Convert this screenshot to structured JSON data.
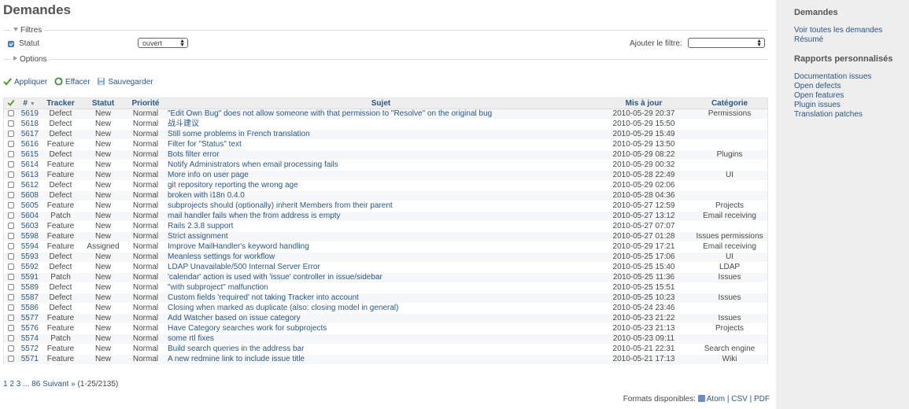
{
  "page": {
    "title": "Demandes"
  },
  "filters": {
    "legend": "Filtres",
    "statut_label": "Statut",
    "statut_value": "ouvert",
    "add_filter_label": "Ajouter le filtre:",
    "add_filter_value": "",
    "options_legend": "Options"
  },
  "actions": {
    "apply": "Appliquer",
    "clear": "Effacer",
    "save": "Sauvegarder"
  },
  "table": {
    "headers": [
      "#",
      "Tracker",
      "Statut",
      "Priorité",
      "Sujet",
      "Mis à jour",
      "Catégorie"
    ],
    "rows": [
      {
        "id": "5619",
        "tracker": "Defect",
        "status": "New",
        "priority": "Normal",
        "subject": "\"Edit Own Bug\" does not allow someone with that permission to \"Resolve\" on the original bug",
        "updated": "2010-05-29 20:37",
        "category": "Permissions"
      },
      {
        "id": "5618",
        "tracker": "Defect",
        "status": "New",
        "priority": "Normal",
        "subject": "战斗建议",
        "updated": "2010-05-29 15:50",
        "category": ""
      },
      {
        "id": "5617",
        "tracker": "Defect",
        "status": "New",
        "priority": "Normal",
        "subject": "Still some problems in French translation",
        "updated": "2010-05-29 15:49",
        "category": ""
      },
      {
        "id": "5616",
        "tracker": "Feature",
        "status": "New",
        "priority": "Normal",
        "subject": "Filter for \"Status\" text",
        "updated": "2010-05-29 13:50",
        "category": ""
      },
      {
        "id": "5615",
        "tracker": "Defect",
        "status": "New",
        "priority": "Normal",
        "subject": "Bots filter error",
        "updated": "2010-05-29 08:22",
        "category": "Plugins"
      },
      {
        "id": "5614",
        "tracker": "Feature",
        "status": "New",
        "priority": "Normal",
        "subject": "Notify Administrators when email processing fails",
        "updated": "2010-05-29 00:32",
        "category": ""
      },
      {
        "id": "5613",
        "tracker": "Feature",
        "status": "New",
        "priority": "Normal",
        "subject": "More info on user page",
        "updated": "2010-05-28 22:49",
        "category": "UI"
      },
      {
        "id": "5612",
        "tracker": "Defect",
        "status": "New",
        "priority": "Normal",
        "subject": "git repository reporting the wrong age",
        "updated": "2010-05-29 02:06",
        "category": ""
      },
      {
        "id": "5608",
        "tracker": "Defect",
        "status": "New",
        "priority": "Normal",
        "subject": "broken with i18n 0.4.0",
        "updated": "2010-05-28 04:36",
        "category": ""
      },
      {
        "id": "5605",
        "tracker": "Feature",
        "status": "New",
        "priority": "Normal",
        "subject": "subprojects should (optionally) inherit Members from their parent",
        "updated": "2010-05-27 12:59",
        "category": "Projects"
      },
      {
        "id": "5604",
        "tracker": "Patch",
        "status": "New",
        "priority": "Normal",
        "subject": "mail handler fails when the from address is empty",
        "updated": "2010-05-27 13:12",
        "category": "Email receiving"
      },
      {
        "id": "5603",
        "tracker": "Feature",
        "status": "New",
        "priority": "Normal",
        "subject": "Rails 2.3.8 support",
        "updated": "2010-05-27 07:07",
        "category": ""
      },
      {
        "id": "5598",
        "tracker": "Feature",
        "status": "New",
        "priority": "Normal",
        "subject": "Strict assignment",
        "updated": "2010-05-27 01:28",
        "category": "Issues permissions"
      },
      {
        "id": "5594",
        "tracker": "Feature",
        "status": "Assigned",
        "priority": "Normal",
        "subject": "Improve MailHandler's keyword handling",
        "updated": "2010-05-29 17:21",
        "category": "Email receiving"
      },
      {
        "id": "5593",
        "tracker": "Defect",
        "status": "New",
        "priority": "Normal",
        "subject": "Meanless settings for workflow",
        "updated": "2010-05-25 17:06",
        "category": "UI"
      },
      {
        "id": "5592",
        "tracker": "Defect",
        "status": "New",
        "priority": "Normal",
        "subject": "LDAP Unavailable/500 Internal Server Error",
        "updated": "2010-05-25 15:40",
        "category": "LDAP"
      },
      {
        "id": "5591",
        "tracker": "Patch",
        "status": "New",
        "priority": "Normal",
        "subject": "'calendar' action is used with 'issue' controller in issue/sidebar",
        "updated": "2010-05-25 11:36",
        "category": "Issues"
      },
      {
        "id": "5589",
        "tracker": "Defect",
        "status": "New",
        "priority": "Normal",
        "subject": "\"with subproject\" malfunction",
        "updated": "2010-05-25 15:51",
        "category": ""
      },
      {
        "id": "5587",
        "tracker": "Defect",
        "status": "New",
        "priority": "Normal",
        "subject": "Custom fields 'required' not taking Tracker into account",
        "updated": "2010-05-25 10:23",
        "category": "Issues"
      },
      {
        "id": "5586",
        "tracker": "Defect",
        "status": "New",
        "priority": "Normal",
        "subject": "Closing when marked as duplicate (also: closing model in general)",
        "updated": "2010-05-24 23:46",
        "category": ""
      },
      {
        "id": "5577",
        "tracker": "Feature",
        "status": "New",
        "priority": "Normal",
        "subject": "Add Watcher based on issue category",
        "updated": "2010-05-23 21:22",
        "category": "Issues"
      },
      {
        "id": "5576",
        "tracker": "Feature",
        "status": "New",
        "priority": "Normal",
        "subject": "Have Category searches work for subprojects",
        "updated": "2010-05-23 21:13",
        "category": "Projects"
      },
      {
        "id": "5574",
        "tracker": "Patch",
        "status": "New",
        "priority": "Normal",
        "subject": "some rtl fixes",
        "updated": "2010-05-23 09:11",
        "category": ""
      },
      {
        "id": "5572",
        "tracker": "Feature",
        "status": "New",
        "priority": "Normal",
        "subject": "Build search queries in the address bar",
        "updated": "2010-05-21 22:31",
        "category": "Search engine"
      },
      {
        "id": "5571",
        "tracker": "Feature",
        "status": "New",
        "priority": "Normal",
        "subject": "A new redmine link to include issue title",
        "updated": "2010-05-21 17:13",
        "category": "Wiki"
      }
    ]
  },
  "pagination": {
    "pages": [
      "1",
      "2",
      "3"
    ],
    "ellipsis": "...",
    "last": "86",
    "next": "Suivant »",
    "count": "(1-25/2135)"
  },
  "formats": {
    "label": "Formats disponibles:",
    "atom": "Atom",
    "csv": "CSV",
    "pdf": "PDF",
    "sep": "|"
  },
  "sidebar": {
    "heading1": "Demandes",
    "links1": [
      "Voir toutes les demandes",
      "Résumé"
    ],
    "heading2": "Rapports personnalisés",
    "links2": [
      "Documentation issues",
      "Open defects",
      "Open features",
      "Plugin issues",
      "Translation patches"
    ]
  },
  "colors": {
    "link": "#2a5685",
    "sidebar_bg": "#eeeeee",
    "header_bg": "#eeeeee",
    "row_odd": "#f6f7f8"
  }
}
